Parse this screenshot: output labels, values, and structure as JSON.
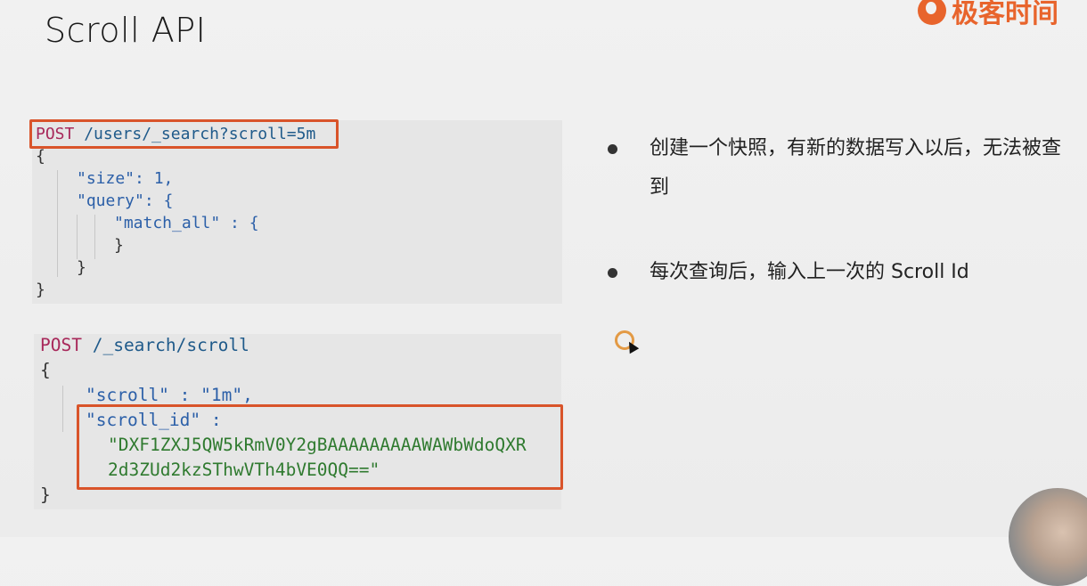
{
  "slide": {
    "title": "Scroll API",
    "logo_text": "极客时间"
  },
  "code_block_1": {
    "lines": [
      "POST /users/_search?scroll=5m",
      "{",
      "\"size\": 1,",
      "\"query\": {",
      "\"match_all\" : {",
      "}",
      "}",
      "}"
    ],
    "method": "POST",
    "path": "/users/_search?scroll=5m"
  },
  "code_block_2": {
    "method": "POST",
    "path": "/_search/scroll",
    "lines": [
      "{",
      "\"scroll\" : \"1m\",",
      "\"scroll_id\" :",
      "\"DXF1ZXJ5QW5kRmV0Y2gBAAAAAAAAAWAWbWdoQXR",
      "2d3ZUd2kzSThwVTh4bVE0QQ==\"",
      "}"
    ]
  },
  "bullets": [
    {
      "text": "创建一个快照，有新的数据写入以后，无法被查到"
    },
    {
      "text": "每次查询后，输入上一次的 Scroll Id"
    }
  ],
  "colors": {
    "accent_box": "#d9542a",
    "code_bg": "#e6e6e6",
    "cursor_ring": "#e39a45"
  },
  "icons": [
    "logo-icon",
    "cursor-icon",
    "presenter-avatar"
  ]
}
